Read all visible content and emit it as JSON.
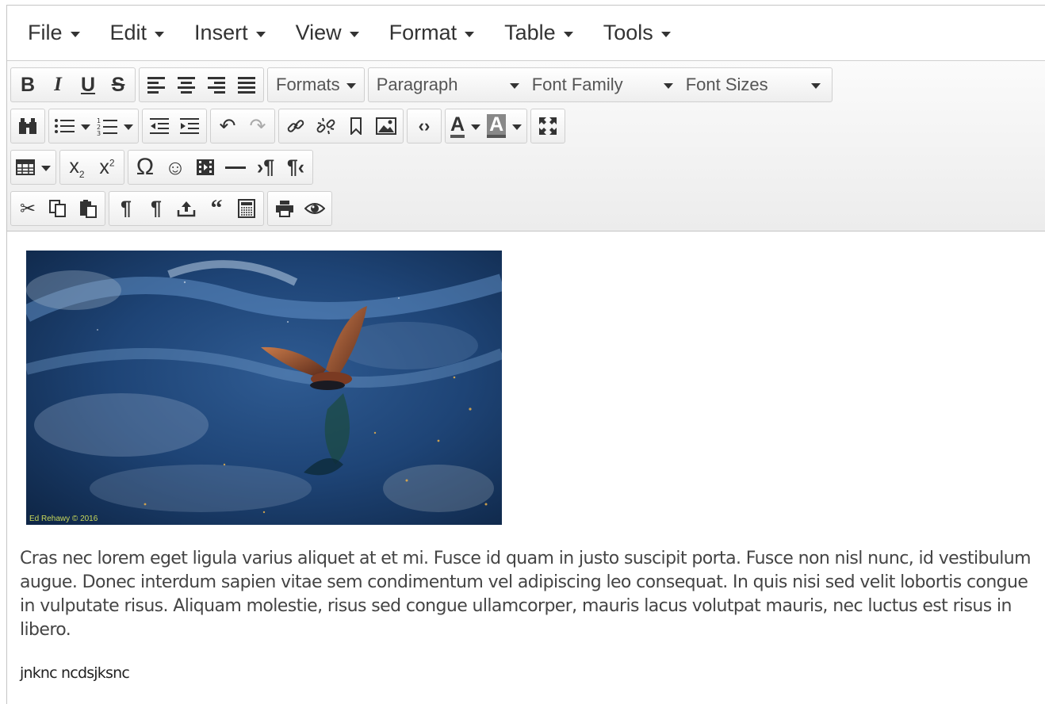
{
  "menubar": {
    "items": [
      {
        "label": "File"
      },
      {
        "label": "Edit"
      },
      {
        "label": "Insert"
      },
      {
        "label": "View"
      },
      {
        "label": "Format"
      },
      {
        "label": "Table"
      },
      {
        "label": "Tools"
      }
    ]
  },
  "toolbar": {
    "formats_label": "Formats",
    "block_format": "Paragraph",
    "font_family": "Font Family",
    "font_sizes": "Font Sizes",
    "bold_glyph": "B",
    "italic_glyph": "I",
    "underline_glyph": "U",
    "strike_glyph": "S",
    "text_color_glyph": "A",
    "bg_color_glyph": "A"
  },
  "content": {
    "image_watermark": "Ed Rehawy © 2016",
    "paragraph": "Cras nec lorem eget ligula varius aliquet at et mi. Fusce id quam in justo suscipit porta. Fusce non nisl nunc, id vestibulum augue. Donec interdum sapien vitae sem condimentum vel adipiscing leo consequat. In quis nisi sed velit lobortis congue in vulputate risus. Aliquam molestie, risus sed congue ullamcorper, mauris lacus volutpat mauris, nec luctus est risus in libero.",
    "line2": "jnknc ncdsjksnc"
  },
  "colors": {
    "toolbar_bg": "#efefef",
    "border": "#c5c5c5",
    "text": "#333333"
  }
}
